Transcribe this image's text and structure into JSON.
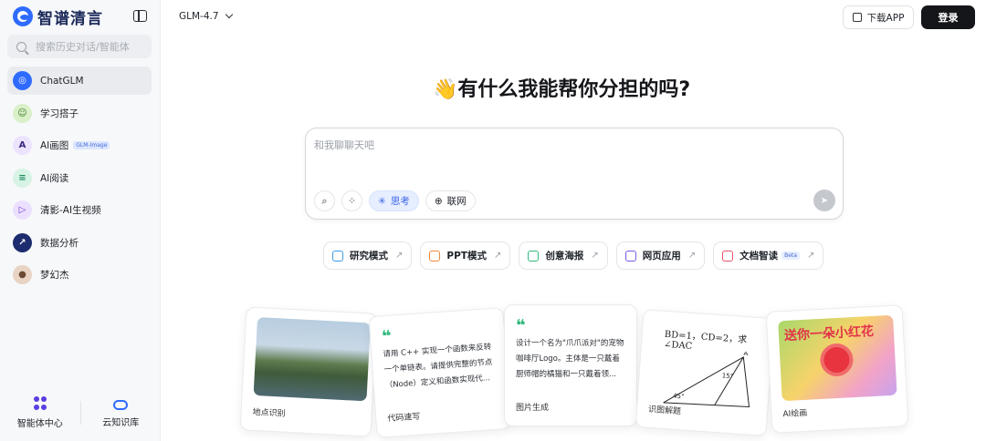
{
  "sidebar": {
    "brand": "智谱清言",
    "search_placeholder": "搜索历史对话/智能体",
    "items": [
      {
        "label": "ChatGLM",
        "icon": "chatglm-icon"
      },
      {
        "label": "学习搭子",
        "icon": "study-buddy-icon"
      },
      {
        "label": "AI画图",
        "icon": "ai-draw-icon",
        "badge": "GLM-Image"
      },
      {
        "label": "AI阅读",
        "icon": "ai-read-icon"
      },
      {
        "label": "清影-AI生视频",
        "icon": "video-icon"
      },
      {
        "label": "数据分析",
        "icon": "data-analysis-icon"
      },
      {
        "label": "梦幻杰",
        "icon": "user-avatar-icon"
      }
    ],
    "bottom": {
      "agents": "智能体中心",
      "knowledge": "云知识库"
    }
  },
  "header": {
    "model": "GLM-4.7",
    "download": "下载APP",
    "login": "登录"
  },
  "main": {
    "headline": "👋有什么我能帮你分担的吗?",
    "input_placeholder": "和我聊聊天吧",
    "think_label": "思考",
    "web_label": "联网",
    "features": [
      {
        "label": "研究模式",
        "color": "#3c9be6"
      },
      {
        "label": "PPT模式",
        "color": "#f08a3c"
      },
      {
        "label": "创意海报",
        "color": "#2fb87a"
      },
      {
        "label": "网页应用",
        "color": "#7a5ae6"
      },
      {
        "label": "文档智读",
        "color": "#e6506a",
        "badge": "Beta"
      }
    ],
    "cards": [
      {
        "label": "地点识别"
      },
      {
        "label": "代码速写",
        "text": "请用 C++ 实现一个函数来反转一个单链表。请提供完整的节点（Node）定义和函数实现代..."
      },
      {
        "label": "图片生成",
        "text": "设计一个名为\"爪爪派对\"的宠物咖啡厅Logo。主体是一只戴着厨师帽的橘猫和一只戴着领..."
      },
      {
        "label": "识图解题",
        "problem": "BD=1，CD=2，求∠DAC",
        "angle1": "45°",
        "angle2": "15°",
        "vertex": "A"
      },
      {
        "label": "AI绘画",
        "image_text": "送你一朵小红花"
      }
    ]
  }
}
